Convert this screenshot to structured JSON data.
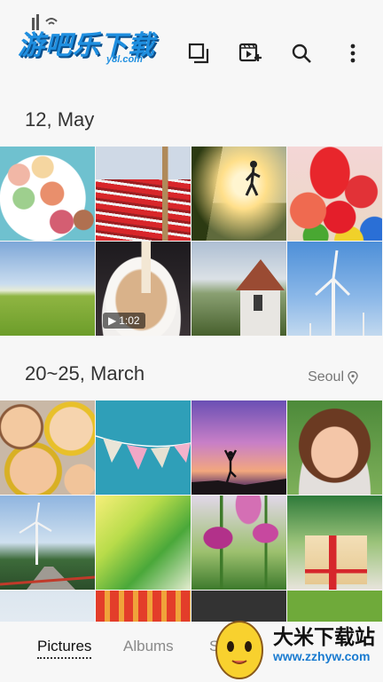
{
  "logo": {
    "text": "游吧乐下载",
    "sub": "y8l.com"
  },
  "toolbar": {
    "icons": [
      "select-icon",
      "create-video-icon",
      "search-icon",
      "more-icon"
    ]
  },
  "sections": [
    {
      "title": "12, May",
      "location": ""
    },
    {
      "title": "20~25, March",
      "location": "Seoul"
    }
  ],
  "photos": {
    "may": [
      {
        "name": "macarons"
      },
      {
        "name": "big-ben-bus"
      },
      {
        "name": "runner-sunset"
      },
      {
        "name": "heart-balloons"
      },
      {
        "name": "green-field"
      },
      {
        "name": "coffee-pour",
        "video": "1:02"
      },
      {
        "name": "church-tower"
      },
      {
        "name": "wind-turbines"
      }
    ],
    "march": [
      {
        "name": "cookies"
      },
      {
        "name": "bunting-flags"
      },
      {
        "name": "yoga-silhouette"
      },
      {
        "name": "smiling-girl"
      },
      {
        "name": "wind-turbine-road"
      },
      {
        "name": "green-leaf"
      },
      {
        "name": "tulips"
      },
      {
        "name": "christmas-gift"
      }
    ]
  },
  "tabs": [
    {
      "label": "Pictures",
      "active": true
    },
    {
      "label": "Albums",
      "active": false
    },
    {
      "label": "S",
      "active": false
    }
  ],
  "watermark": {
    "text": "大米下载站",
    "url": "www.zzhyw.com"
  }
}
